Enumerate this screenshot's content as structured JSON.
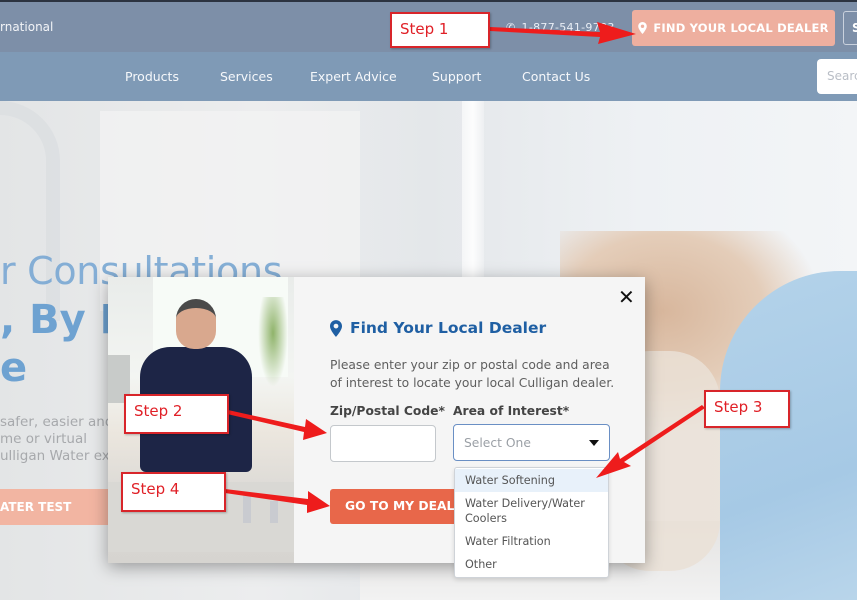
{
  "topbar": {
    "brand_text": "rnational",
    "phone": "1-877-541-9783",
    "phone_icon": "phone-icon",
    "find_dealer_label": "FIND YOUR LOCAL DEALER",
    "find_dealer_icon": "map-marker-icon",
    "extra_button_label": "S"
  },
  "nav": {
    "items": [
      {
        "label": "Products"
      },
      {
        "label": "Services"
      },
      {
        "label": "Expert Advice"
      },
      {
        "label": "Support"
      },
      {
        "label": "Contact Us"
      }
    ],
    "search_placeholder": "Search"
  },
  "hero": {
    "title_line1": "r Consultations",
    "title_line2": ", By P",
    "title_line3": "e",
    "body_lines": [
      "safer, easier and",
      "me or virtual",
      "ulligan Water exp"
    ],
    "cta_label": "ATER TEST"
  },
  "modal": {
    "close_icon": "close-icon",
    "title_icon": "map-marker-icon",
    "title": "Find Your Local Dealer",
    "description": "Please enter your zip or postal code and area of interest to locate your local Culligan dealer.",
    "zip_label": "Zip/Postal Code*",
    "zip_value": "",
    "area_label": "Area of Interest*",
    "area_selected": "Select One",
    "area_options": [
      "Water Softening",
      "Water Delivery/Water Coolers",
      "Water Filtration",
      "Other"
    ],
    "area_highlighted": "Water Softening",
    "submit_label": "GO TO MY DEALER"
  },
  "annotations": {
    "steps": [
      "Step 1",
      "Step 2",
      "Step 3",
      "Step 4"
    ],
    "color": "#e02027"
  },
  "colors": {
    "topbar": "#7d8fa8",
    "navbar": "#7f9ab6",
    "find_dealer_button": "#eeaf9f",
    "submit_button": "#e8674a",
    "modal_title": "#1f5fa3",
    "hero_title": "#6ea2d1"
  }
}
